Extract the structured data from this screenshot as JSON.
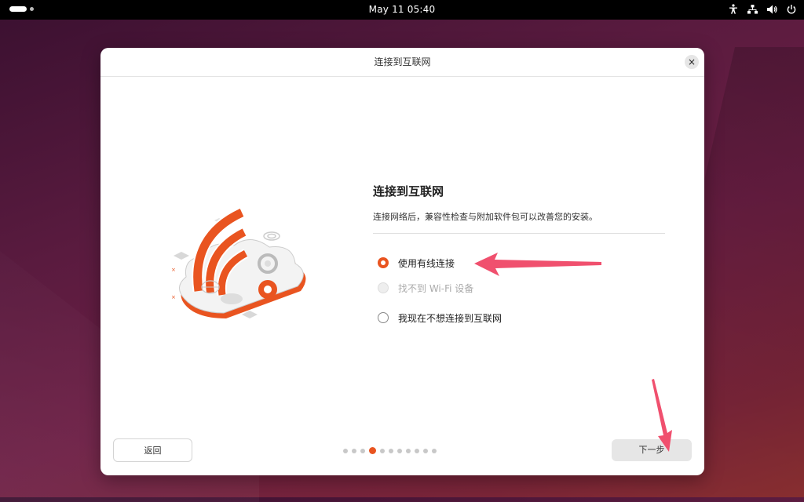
{
  "topbar": {
    "clock": "May 11  05:40",
    "icons": [
      "accessibility-icon",
      "network-icon",
      "volume-icon",
      "power-icon"
    ]
  },
  "dialog": {
    "title": "连接到互联网",
    "close_label": "×"
  },
  "content": {
    "heading": "连接到互联网",
    "description": "连接网络后，兼容性检查与附加软件包可以改善您的安装。",
    "options": [
      {
        "label": "使用有线连接",
        "state": "checked"
      },
      {
        "label": "找不到 Wi-Fi 设备",
        "state": "disabled"
      },
      {
        "label": "我现在不想连接到互联网",
        "state": "unchecked"
      }
    ]
  },
  "footer": {
    "back_label": "返回",
    "next_label": "下一步",
    "pager": {
      "total": 11,
      "current": 4
    }
  },
  "colors": {
    "accent": "#e95420",
    "annotation_arrow": "#f0506e"
  }
}
